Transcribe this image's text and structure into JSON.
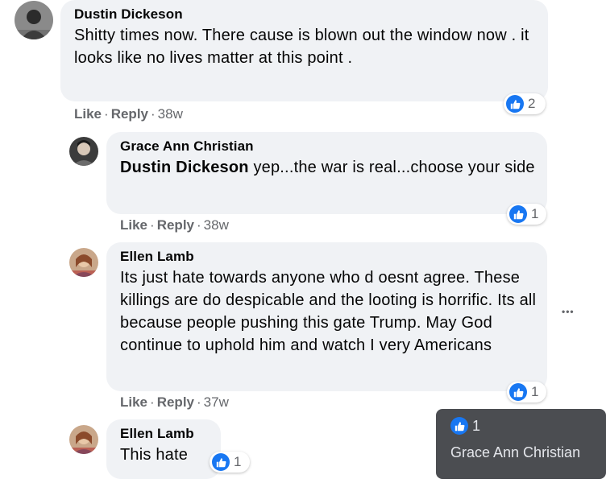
{
  "comments": [
    {
      "author": "Dustin Dickeson",
      "text": "Shitty times now. There cause is blown out the window now . it looks like no lives matter at this point .",
      "actions": {
        "like": "Like",
        "reply": "Reply",
        "time": "38w"
      },
      "reactions": {
        "count": "2"
      }
    },
    {
      "author": "Grace Ann Christian",
      "mention": "Dustin Dickeson",
      "text": " yep...the war is real...choose your side",
      "actions": {
        "like": "Like",
        "reply": "Reply",
        "time": "38w"
      },
      "reactions": {
        "count": "1"
      }
    },
    {
      "author": "Ellen Lamb",
      "text": "Its just hate towards anyone who d oesnt agree. These killings are do despicable and the looting is horrific. Its all because people pushing this gate Trump. May God continue to uphold him and watch I very Americans",
      "actions": {
        "like": "Like",
        "reply": "Reply",
        "time": "37w"
      },
      "reactions": {
        "count": "1"
      }
    },
    {
      "author": "Ellen Lamb",
      "text": "This hate",
      "reactions": {
        "count": "1"
      }
    }
  ],
  "more_menu": "•••",
  "tooltip": {
    "count": "1",
    "name": "Grace Ann Christian"
  },
  "separator": "·",
  "colors": {
    "like_blue": "#1877f2",
    "bubble": "#f0f2f5",
    "muted": "#65676b"
  }
}
